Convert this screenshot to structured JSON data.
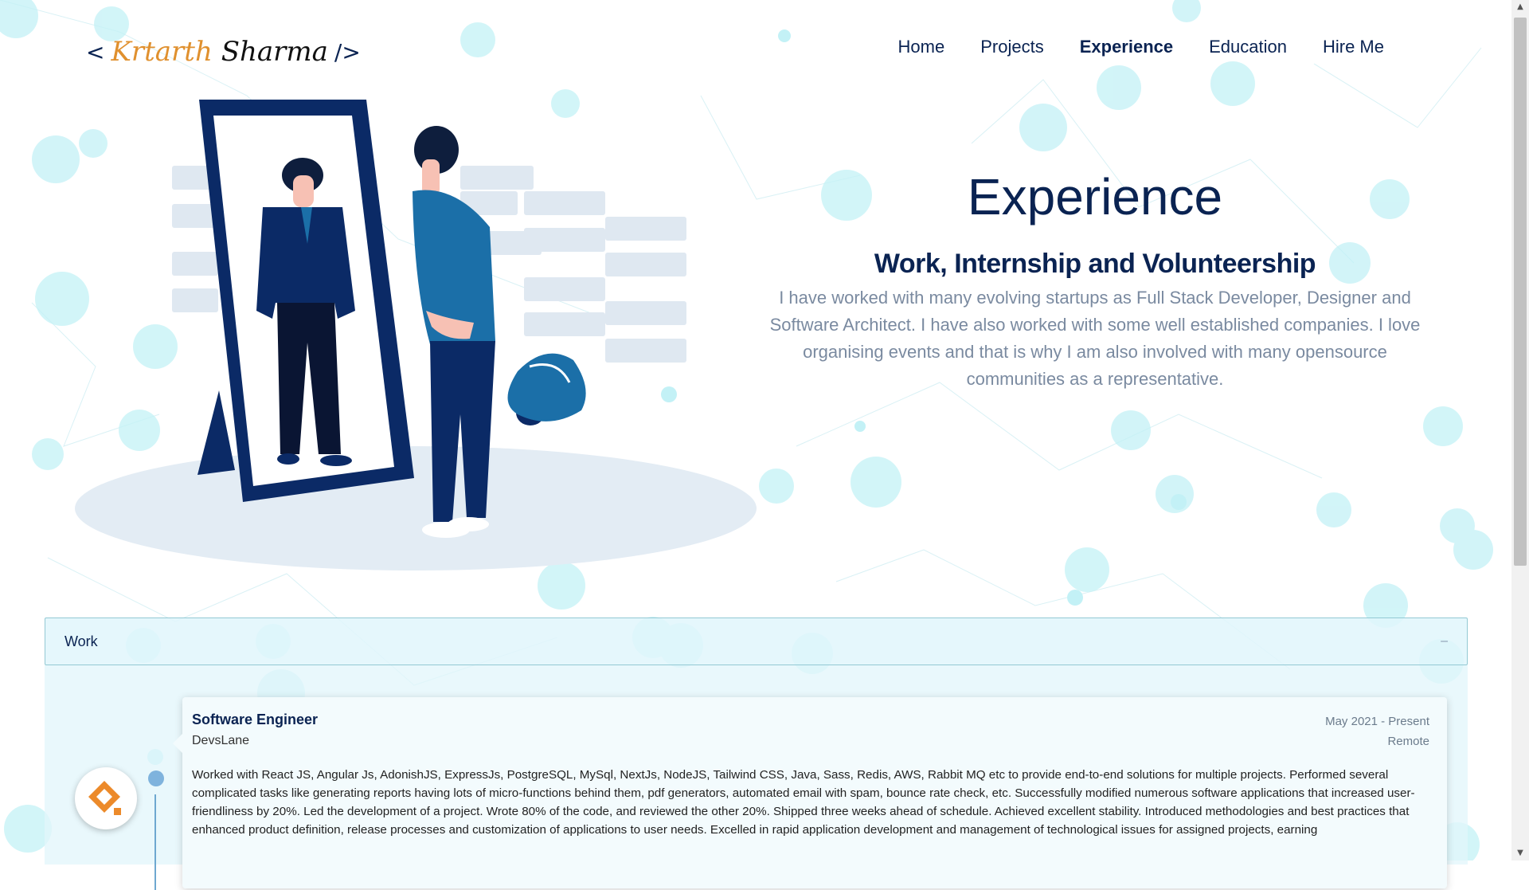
{
  "header": {
    "logo_open": "<",
    "logo_first": "Krtarth",
    "logo_last": "Sharma",
    "logo_close": "/>",
    "nav": [
      {
        "label": "Home",
        "active": false
      },
      {
        "label": "Projects",
        "active": false
      },
      {
        "label": "Experience",
        "active": true
      },
      {
        "label": "Education",
        "active": false
      },
      {
        "label": "Hire Me",
        "active": false
      }
    ]
  },
  "hero": {
    "title": "Experience",
    "subtitle": "Work, Internship and Volunteership",
    "description": "I have worked with many evolving startups as Full Stack Developer, Designer and Software Architect. I have also worked with some well established companies. I love organising events and that is why I am also involved with many opensource communities as a representative."
  },
  "accordion": {
    "title": "Work",
    "toggle": "–",
    "entries": [
      {
        "role": "Software Engineer",
        "company": "DevsLane",
        "date": "May 2021 - Present",
        "location": "Remote",
        "description": "Worked with React JS, Angular Js, AdonishJS, ExpressJs, PostgreSQL, MySql, NextJs, NodeJS, Tailwind CSS, Java, Sass, Redis, AWS, Rabbit MQ etc to provide end-to-end solutions for multiple projects. Performed several complicated tasks like generating reports having lots of micro-functions behind them, pdf generators, automated email with spam, bounce rate check, etc. Successfully modified numerous software applications that increased user-friendliness by 20%. Led the development of a project. Wrote 80% of the code, and reviewed the other 20%. Shipped three weeks ahead of schedule. Achieved excellent stability. Introduced methodologies and best practices that enhanced product definition, release processes and customization of applications to user needs. Excelled in rapid application development and management of technological issues for assigned projects, earning"
      }
    ]
  },
  "colors": {
    "primary": "#0a2352",
    "accent_blue": "#1b6fa8",
    "muted_text": "#7a8aa0",
    "bubble": "#bff0f5",
    "logo_orange": "#e8892b"
  }
}
